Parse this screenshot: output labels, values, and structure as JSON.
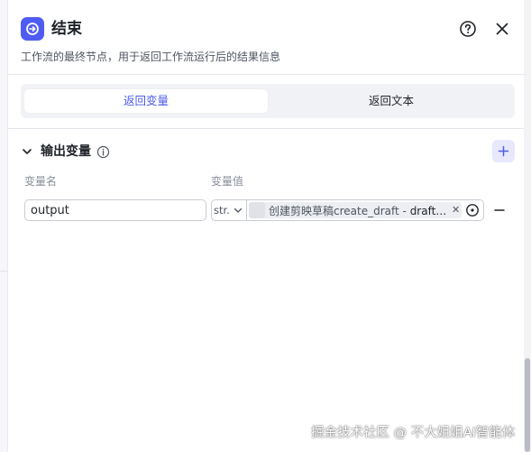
{
  "panel": {
    "title": "结束",
    "description": "工作流的最终节点，用于返回工作流运行后的结果信息",
    "icon": "end-node-icon",
    "accent_color": "#4f5cf2"
  },
  "tabs": [
    {
      "label": "返回变量",
      "active": true
    },
    {
      "label": "返回文本",
      "active": false
    }
  ],
  "output_section": {
    "title": "输出变量",
    "col_name_label": "变量名",
    "col_value_label": "变量值",
    "rows": [
      {
        "name": "output",
        "type": "str.",
        "ref_node": "创建剪映草稿create_draft",
        "ref_sep": " - ",
        "ref_var": "draft…"
      }
    ]
  },
  "watermark": "掘金技术社区 @ 不大姐姐AI智能体"
}
